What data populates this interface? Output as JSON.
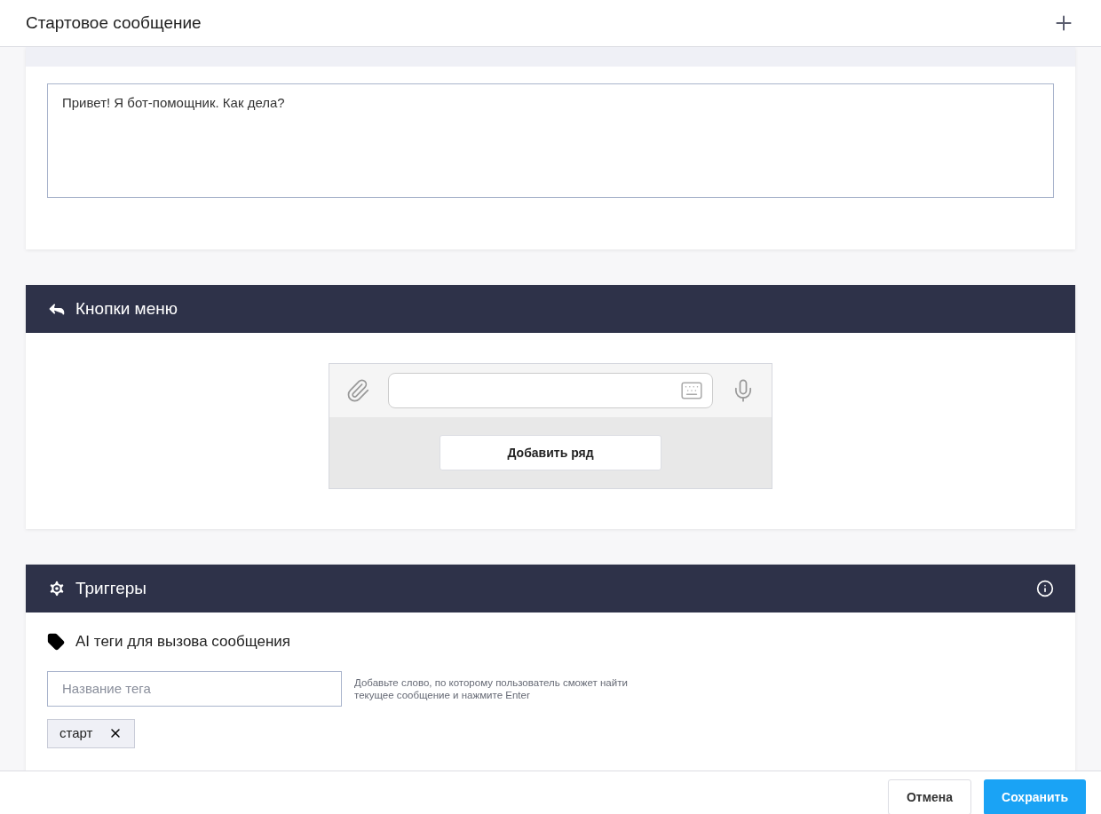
{
  "window": {
    "title": "Стартовое сообщение"
  },
  "text_section": {
    "message": "Привет! Я бот-помощник. Как дела?"
  },
  "menu_section": {
    "title": "Кнопки меню",
    "add_row_button": "Добавить ряд"
  },
  "triggers_section": {
    "title": "Триггеры",
    "subtitle": "AI теги для вызова сообщения",
    "tag_field": {
      "placeholder": "Название тега"
    },
    "hint": "Добавьте слово, по которому пользователь сможет найти текущее сообщение и нажмите Enter",
    "tags": [
      {
        "label": "старт"
      }
    ]
  },
  "footer": {
    "cancel": "Отмена",
    "save": "Сохранить"
  }
}
